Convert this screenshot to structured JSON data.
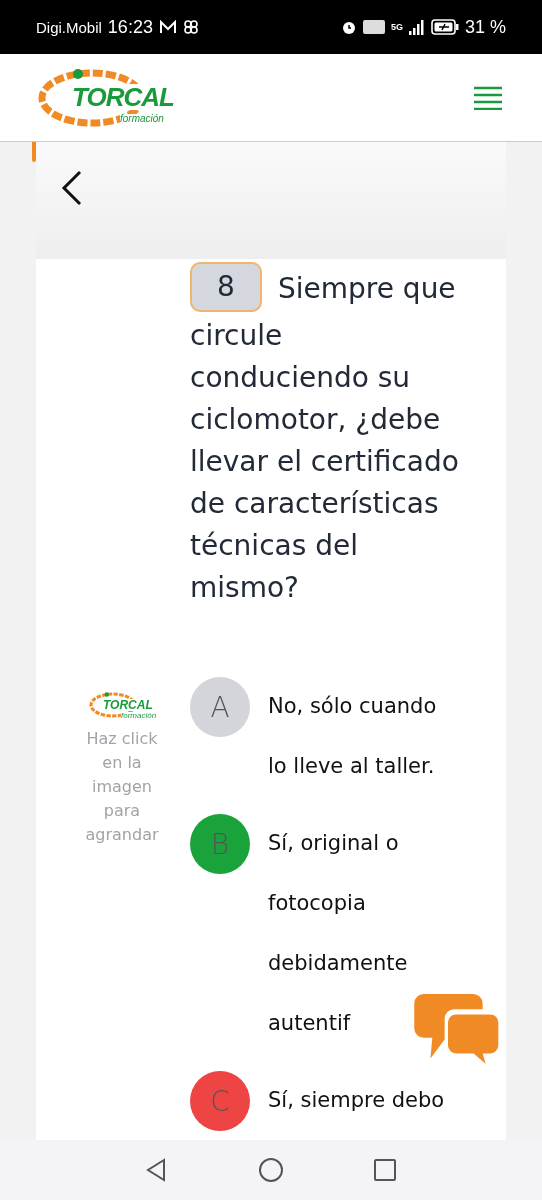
{
  "status_bar": {
    "carrier": "Digi.Mobil",
    "time": "16:23",
    "network": "5G",
    "battery": "31 %"
  },
  "header": {
    "logo": {
      "brand": "TORCAL",
      "tagline": "formación"
    }
  },
  "question": {
    "number": "8",
    "text": "Siempre que circule conduciendo su ciclomotor, ¿debe llevar el certificado de características técnicas del mismo?"
  },
  "image_hint": {
    "logo": {
      "brand": "TORCAL",
      "tagline": "formación"
    },
    "text": "Haz click en la imagen para agrandar"
  },
  "answers": [
    {
      "letter": "A",
      "text": "No, sólo cuando lo lleve al taller.",
      "color": "#d3d5db"
    },
    {
      "letter": "B",
      "text": "Sí, original o fotocopia debidamente autentif",
      "color": "#1aa33a"
    },
    {
      "letter": "C",
      "text": "Sí, siempre debo",
      "color": "#ee4444"
    }
  ]
}
